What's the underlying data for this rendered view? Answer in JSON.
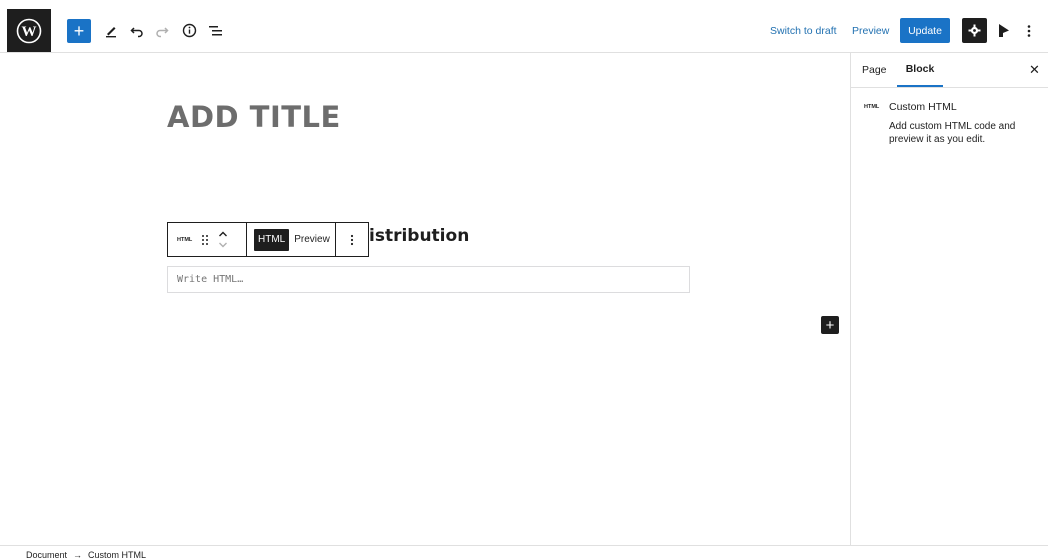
{
  "toolbar": {
    "switch_to_draft": "Switch to draft",
    "preview": "Preview",
    "update": "Update",
    "accent": "#1a73c6"
  },
  "editor": {
    "title_placeholder": "ADD TITLE",
    "heading_fragment": "istribution",
    "block_toolbar": {
      "block_type": "HTML",
      "html_tab": "HTML",
      "preview_tab": "Preview"
    },
    "html_placeholder": "Write HTML…"
  },
  "sidebar": {
    "tabs": [
      "Page",
      "Block"
    ],
    "active_tab": "Block",
    "block_card": {
      "icon_label": "HTML",
      "title": "Custom HTML",
      "description": "Add custom HTML code and preview it as you edit."
    }
  },
  "footer": {
    "breadcrumb": [
      "Document",
      "→",
      "Custom HTML"
    ]
  }
}
